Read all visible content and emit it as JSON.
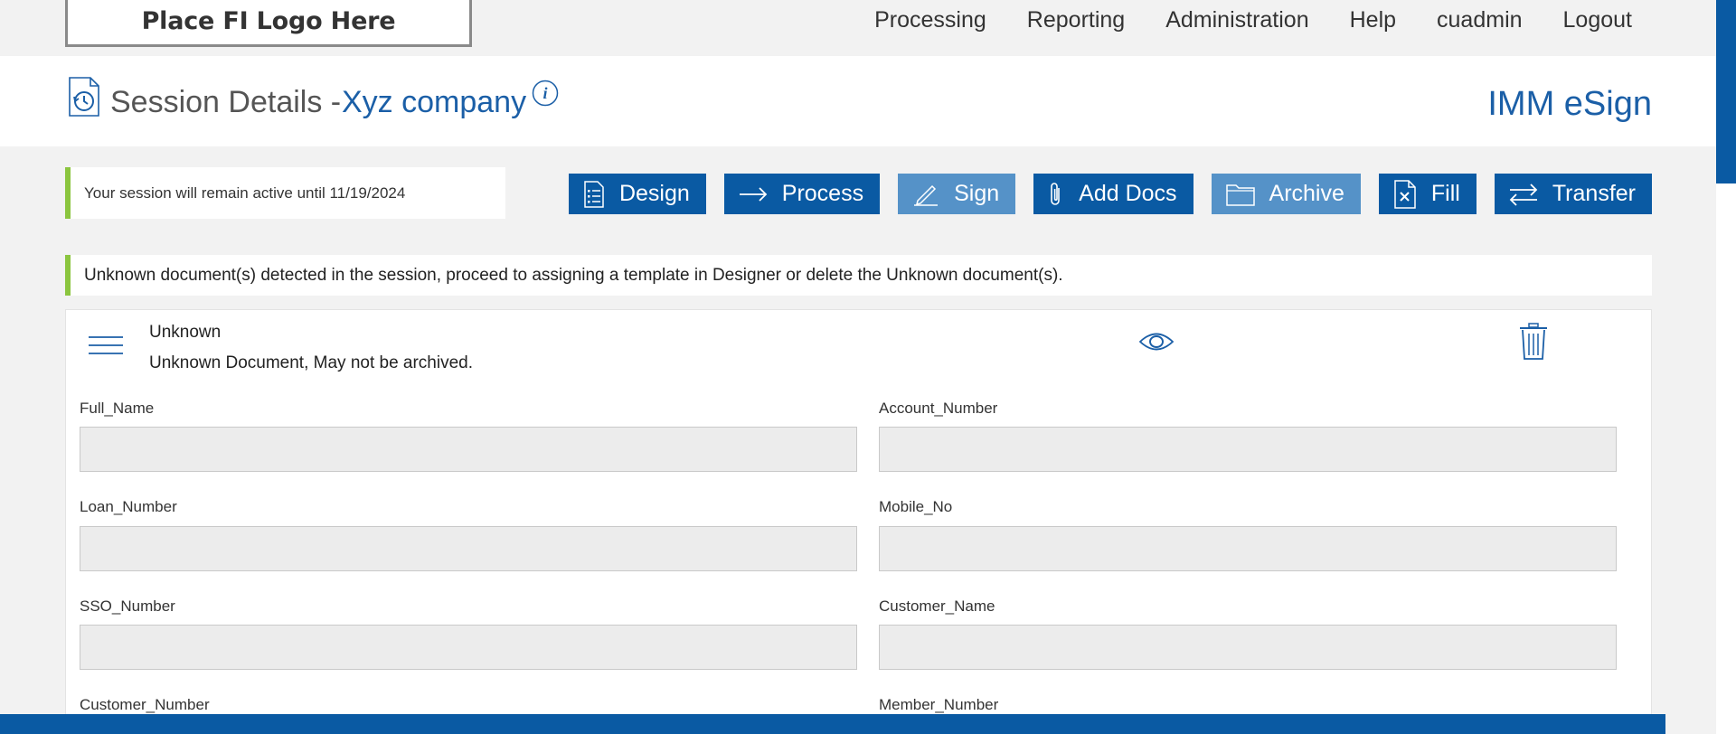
{
  "logo_text": "Place FI Logo Here",
  "nav": [
    "Processing",
    "Reporting",
    "Administration",
    "Help",
    "cuadmin",
    "Logout"
  ],
  "header": {
    "title": "Session Details - ",
    "company": "Xyz company",
    "brand": "IMM eSign"
  },
  "session_notice": "Your session will remain active until 11/19/2024",
  "actions": [
    {
      "label": "Design",
      "icon": "list-icon",
      "style": "dark"
    },
    {
      "label": "Process",
      "icon": "arrow-right-icon",
      "style": "dark"
    },
    {
      "label": "Sign",
      "icon": "pen-icon",
      "style": "light"
    },
    {
      "label": "Add Docs",
      "icon": "paperclip-icon",
      "style": "dark"
    },
    {
      "label": "Archive",
      "icon": "folder-icon",
      "style": "light"
    },
    {
      "label": "Fill",
      "icon": "file-x-icon",
      "style": "dark"
    },
    {
      "label": "Transfer",
      "icon": "swap-icon",
      "style": "dark"
    }
  ],
  "warning": "Unknown document(s) detected in the session, proceed to assigning a template in Designer or delete the Unknown document(s).",
  "document": {
    "name": "Unknown",
    "description": "Unknown Document, May not be archived."
  },
  "fields": [
    {
      "label": "Full_Name",
      "value": ""
    },
    {
      "label": "Account_Number",
      "value": ""
    },
    {
      "label": "Loan_Number",
      "value": ""
    },
    {
      "label": "Mobile_No",
      "value": ""
    },
    {
      "label": "SSO_Number",
      "value": ""
    },
    {
      "label": "Customer_Name",
      "value": ""
    },
    {
      "label": "Customer_Number",
      "value": ""
    },
    {
      "label": "Member_Number",
      "value": ""
    }
  ],
  "colors": {
    "primary": "#0a5aa3",
    "light_button": "#5592c8",
    "accent_green": "#8bc53f",
    "link_blue": "#1b5fa7"
  }
}
